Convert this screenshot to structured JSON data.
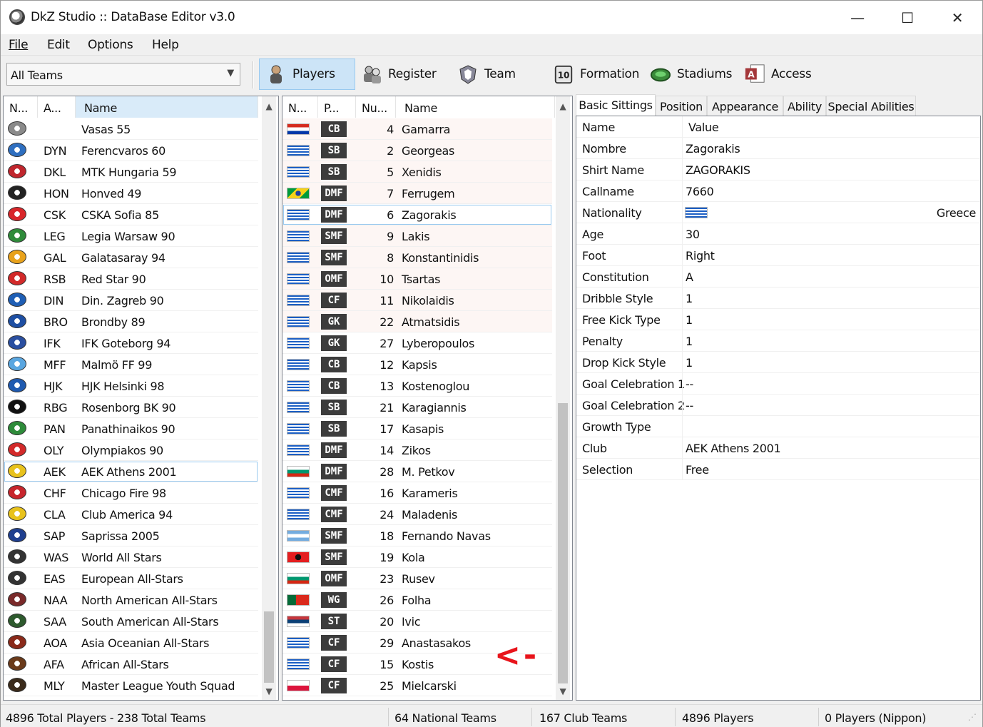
{
  "window": {
    "title": "DkZ Studio :: DataBase Editor v3.0",
    "minimize": "—",
    "maximize": "☐",
    "close": "✕"
  },
  "menu": [
    {
      "label": "File"
    },
    {
      "label": "Edit"
    },
    {
      "label": "Options"
    },
    {
      "label": "Help"
    }
  ],
  "toolbar": {
    "team_filter": "All Teams",
    "buttons": [
      {
        "label": "Players",
        "icon": "player-icon",
        "active": true
      },
      {
        "label": "Register",
        "icon": "register-icon"
      },
      {
        "label": "Team",
        "icon": "team-icon"
      },
      {
        "label": "Formation",
        "icon": "formation-icon"
      },
      {
        "label": "Stadiums",
        "icon": "stadium-icon"
      },
      {
        "label": "Access",
        "icon": "access-icon"
      }
    ]
  },
  "teams": {
    "columns": [
      "N...",
      "A...",
      "Name"
    ],
    "selected_index": 16,
    "rows": [
      {
        "abbr": "",
        "name": "Vasas 55",
        "badge": "#8a8a8a"
      },
      {
        "abbr": "DYN",
        "name": "Ferencvaros 60",
        "badge": "#2f6fc0"
      },
      {
        "abbr": "DKL",
        "name": "MTK Hungaria 59",
        "badge": "#c0262d"
      },
      {
        "abbr": "HON",
        "name": "Honved 49",
        "badge": "#222222"
      },
      {
        "abbr": "CSK",
        "name": "CSKA Sofia 85",
        "badge": "#d8262a"
      },
      {
        "abbr": "LEG",
        "name": "Legia Warsaw 90",
        "badge": "#2e8b3a"
      },
      {
        "abbr": "GAL",
        "name": "Galatasaray 94",
        "badge": "#e8a21c"
      },
      {
        "abbr": "RSB",
        "name": "Red Star 90",
        "badge": "#d22a2a"
      },
      {
        "abbr": "DIN",
        "name": "Din. Zagreb 90",
        "badge": "#1f5fb5"
      },
      {
        "abbr": "BRO",
        "name": "Brondby 89",
        "badge": "#1e4fa3"
      },
      {
        "abbr": "IFK",
        "name": "IFK Goteborg 94",
        "badge": "#2a4fa0"
      },
      {
        "abbr": "MFF",
        "name": "Malmö FF 99",
        "badge": "#5aa6e0"
      },
      {
        "abbr": "HJK",
        "name": "HJK Helsinki 98",
        "badge": "#1f5ab0"
      },
      {
        "abbr": "RBG",
        "name": "Rosenborg BK 90",
        "badge": "#111111"
      },
      {
        "abbr": "PAN",
        "name": "Panathinaikos 90",
        "badge": "#2e8b3a"
      },
      {
        "abbr": "OLY",
        "name": "Olympiakos 90",
        "badge": "#d22a2a"
      },
      {
        "abbr": "AEK",
        "name": "AEK Athens 2001",
        "badge": "#e8c21c"
      },
      {
        "abbr": "CHF",
        "name": "Chicago Fire 98",
        "badge": "#c7262d"
      },
      {
        "abbr": "CLA",
        "name": "Club America 94",
        "badge": "#e8c21c"
      },
      {
        "abbr": "SAP",
        "name": "Saprissa 2005",
        "badge": "#1f3f8f"
      },
      {
        "abbr": "WAS",
        "name": "World All Stars",
        "badge": "#333333"
      },
      {
        "abbr": "EAS",
        "name": "European All-Stars",
        "badge": "#333333"
      },
      {
        "abbr": "NAA",
        "name": "North American All-Stars",
        "badge": "#7a2a2a"
      },
      {
        "abbr": "SAA",
        "name": "South American All-Stars",
        "badge": "#2e5a2e"
      },
      {
        "abbr": "AOA",
        "name": "Asia Oceanian All-Stars",
        "badge": "#8a2a1a"
      },
      {
        "abbr": "AFA",
        "name": "African All-Stars",
        "badge": "#6a3a1a"
      },
      {
        "abbr": "MLY",
        "name": "Master League Youth Squad",
        "badge": "#3a2a1a"
      }
    ]
  },
  "players": {
    "columns": [
      "N...",
      "P...",
      "Nu...",
      "Name"
    ],
    "selected_index": 4,
    "rows": [
      {
        "flag": "paraguay",
        "pos": "CB",
        "num": "4",
        "name": "Gamarra"
      },
      {
        "flag": "greece",
        "pos": "SB",
        "num": "2",
        "name": "Georgeas"
      },
      {
        "flag": "greece",
        "pos": "SB",
        "num": "5",
        "name": "Xenidis"
      },
      {
        "flag": "brazil",
        "pos": "DMF",
        "num": "7",
        "name": "Ferrugem"
      },
      {
        "flag": "greece",
        "pos": "DMF",
        "num": "6",
        "name": "Zagorakis"
      },
      {
        "flag": "greece",
        "pos": "SMF",
        "num": "9",
        "name": "Lakis"
      },
      {
        "flag": "greece",
        "pos": "SMF",
        "num": "8",
        "name": "Konstantinidis"
      },
      {
        "flag": "greece",
        "pos": "OMF",
        "num": "10",
        "name": "Tsartas"
      },
      {
        "flag": "greece",
        "pos": "CF",
        "num": "11",
        "name": "Nikolaidis"
      },
      {
        "flag": "greece",
        "pos": "GK",
        "num": "22",
        "name": "Atmatsidis"
      },
      {
        "flag": "greece",
        "pos": "GK",
        "num": "27",
        "name": "Lyberopoulos"
      },
      {
        "flag": "greece",
        "pos": "CB",
        "num": "12",
        "name": "Kapsis"
      },
      {
        "flag": "greece",
        "pos": "CB",
        "num": "13",
        "name": "Kostenoglou"
      },
      {
        "flag": "greece",
        "pos": "SB",
        "num": "21",
        "name": "Karagiannis"
      },
      {
        "flag": "greece",
        "pos": "SB",
        "num": "17",
        "name": "Kasapis"
      },
      {
        "flag": "greece",
        "pos": "DMF",
        "num": "14",
        "name": "Zikos"
      },
      {
        "flag": "bulgaria",
        "pos": "DMF",
        "num": "28",
        "name": "M. Petkov"
      },
      {
        "flag": "greece",
        "pos": "CMF",
        "num": "16",
        "name": "Karameris"
      },
      {
        "flag": "greece",
        "pos": "CMF",
        "num": "24",
        "name": "Maladenis"
      },
      {
        "flag": "argentina",
        "pos": "SMF",
        "num": "18",
        "name": "Fernando Navas"
      },
      {
        "flag": "albania",
        "pos": "SMF",
        "num": "19",
        "name": "Kola"
      },
      {
        "flag": "bulgaria",
        "pos": "OMF",
        "num": "23",
        "name": "Rusev"
      },
      {
        "flag": "portugal",
        "pos": "WG",
        "num": "26",
        "name": "Folha"
      },
      {
        "flag": "serbia",
        "pos": "ST",
        "num": "20",
        "name": "Ivic"
      },
      {
        "flag": "greece",
        "pos": "CF",
        "num": "29",
        "name": "Anastasakos"
      },
      {
        "flag": "greece",
        "pos": "CF",
        "num": "15",
        "name": "Kostis"
      },
      {
        "flag": "poland",
        "pos": "CF",
        "num": "25",
        "name": "Mielcarski"
      }
    ]
  },
  "annotation": {
    "text": "<-",
    "color": "#e8141b"
  },
  "details": {
    "tabs": [
      "Basic Sittings",
      "Position",
      "Appearance",
      "Ability",
      "Special Abilities"
    ],
    "active_tab": 0,
    "header": {
      "name": "Name",
      "value": "Value"
    },
    "rows": [
      {
        "name": "Nombre",
        "value": "Zagorakis"
      },
      {
        "name": "Shirt Name",
        "value": "ZAGORAKIS"
      },
      {
        "name": "Callname",
        "value": "7660"
      },
      {
        "name": "Nationality",
        "value": "Greece",
        "flag": "greece"
      },
      {
        "name": "Age",
        "value": "30"
      },
      {
        "name": "Foot",
        "value": "Right"
      },
      {
        "name": "Constitution",
        "value": "A"
      },
      {
        "name": "Dribble Style",
        "value": "1"
      },
      {
        "name": "Free Kick Type",
        "value": "1"
      },
      {
        "name": "Penalty",
        "value": "1"
      },
      {
        "name": "Drop Kick Style",
        "value": "1"
      },
      {
        "name": "Goal Celebration 1",
        "value": "--"
      },
      {
        "name": "Goal Celebration 2",
        "value": "--"
      },
      {
        "name": "Growth Type",
        "value": ""
      },
      {
        "name": "Club",
        "value": "AEK Athens 2001"
      },
      {
        "name": "Selection",
        "value": "Free"
      }
    ]
  },
  "status": {
    "total": "4896 Total Players  -  238 Total Teams",
    "national": "64 National Teams",
    "club": "167 Club Teams",
    "players": "4896 Players",
    "nippon": "0 Players (Nippon)"
  },
  "colors": {
    "selection": "#cce4f7",
    "selection_border": "#99c9ef",
    "position_badge": "#3c3c3c",
    "annotation": "#e8141b"
  }
}
